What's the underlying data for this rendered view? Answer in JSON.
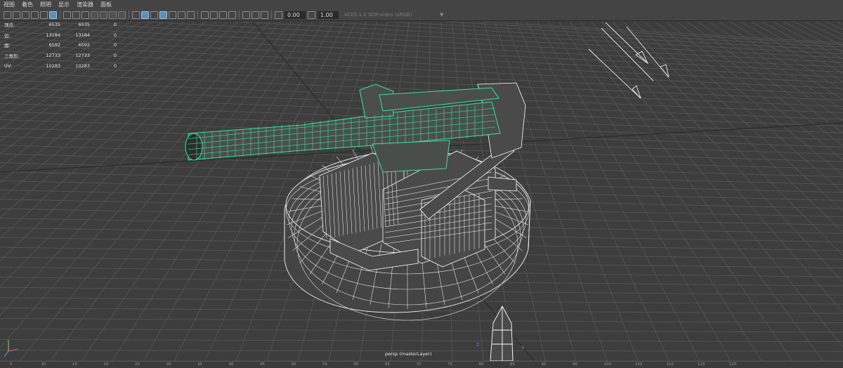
{
  "menu": [
    "视图",
    "着色",
    "照明",
    "显示",
    "渲染器",
    "面板"
  ],
  "toolbar": {
    "exposure": "0.00",
    "gamma": "1.00",
    "color_space": "ACES 1.0 SDR-video (sRGB)"
  },
  "hud": {
    "rows": [
      {
        "label": "顶点:",
        "c1": "6535",
        "c2": "6535",
        "c3": "0"
      },
      {
        "label": "边:",
        "c1": "13184",
        "c2": "13184",
        "c3": "0"
      },
      {
        "label": "面:",
        "c1": "6592",
        "c2": "6592",
        "c3": "0"
      },
      {
        "label": "三角形:",
        "c1": "12733",
        "c2": "12733",
        "c3": "0"
      },
      {
        "label": "UV:",
        "c1": "10283",
        "c2": "10283",
        "c3": "0"
      }
    ]
  },
  "camera_label": "persp (masterLayer)",
  "axis": {
    "z": "Z",
    "x": "X"
  },
  "ruler_ticks": [
    "5",
    "10",
    "15",
    "20",
    "25",
    "30",
    "35",
    "40",
    "45",
    "50",
    "55",
    "60",
    "65",
    "70",
    "75",
    "80",
    "85",
    "90",
    "95",
    "100",
    "105",
    "110",
    "115",
    "120"
  ],
  "colors": {
    "selection": "#38e0a0",
    "wire": "#ffffff",
    "grid": "#565656",
    "background": "#3d3d3d"
  }
}
